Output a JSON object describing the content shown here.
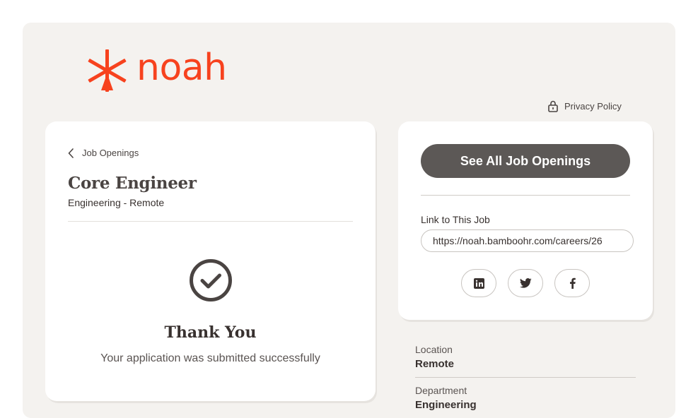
{
  "brand": {
    "name": "noah",
    "color": "#f7421e"
  },
  "header": {
    "privacy_label": "Privacy Policy",
    "privacy_icon": "lock-icon"
  },
  "job": {
    "back_label": "Job Openings",
    "title": "Core Engineer",
    "subtitle": "Engineering - Remote"
  },
  "confirmation": {
    "icon": "check-circle-icon",
    "title": "Thank You",
    "message": "Your application was submitted successfully"
  },
  "share": {
    "see_all_label": "See All Job Openings",
    "link_label": "Link to This Job",
    "link_value": "https://noah.bamboohr.com/careers/26",
    "networks": [
      "linkedin-icon",
      "twitter-icon",
      "facebook-icon"
    ]
  },
  "details": [
    {
      "label": "Location",
      "value": "Remote"
    },
    {
      "label": "Department",
      "value": "Engineering"
    }
  ]
}
